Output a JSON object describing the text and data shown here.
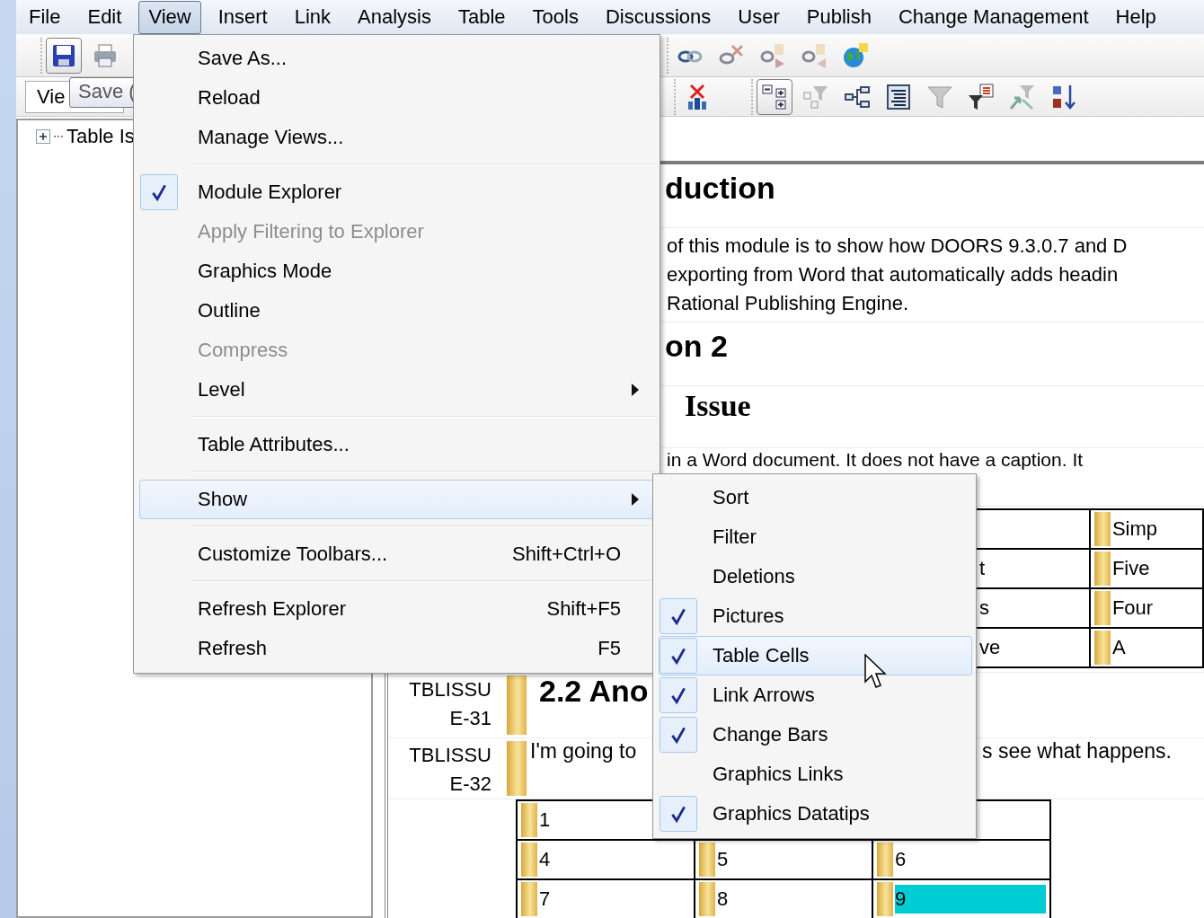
{
  "menu_bar": [
    {
      "label": "File",
      "selected": false
    },
    {
      "label": "Edit",
      "selected": false
    },
    {
      "label": "View",
      "selected": true
    },
    {
      "label": "Insert",
      "selected": false
    },
    {
      "label": "Link",
      "selected": false
    },
    {
      "label": "Analysis",
      "selected": false
    },
    {
      "label": "Table",
      "selected": false
    },
    {
      "label": "Tools",
      "selected": false
    },
    {
      "label": "Discussions",
      "selected": false
    },
    {
      "label": "User",
      "selected": false
    },
    {
      "label": "Publish",
      "selected": false
    },
    {
      "label": "Change Management",
      "selected": false
    },
    {
      "label": "Help",
      "selected": false
    }
  ],
  "toolbars": [
    {
      "groups": [
        {
          "buttons": [
            {
              "kind": "save",
              "pressed": true
            },
            {
              "kind": "print",
              "pressed": false
            }
          ]
        },
        {
          "buttons": [
            {
              "kind": "link",
              "pressed": false
            },
            {
              "kind": "unlink",
              "pressed": false
            },
            {
              "kind": "link_next",
              "pressed": false
            },
            {
              "kind": "link_prev",
              "pressed": false
            },
            {
              "kind": "globe",
              "pressed": false
            }
          ]
        }
      ]
    },
    {
      "view_selector": "Vie",
      "groups": [
        {
          "buttons": [
            {
              "kind": "delete",
              "pressed": false
            }
          ]
        },
        {
          "buttons": [
            {
              "kind": "outline",
              "pressed": true
            },
            {
              "kind": "tree_filter",
              "pressed": false
            },
            {
              "kind": "hierarchy",
              "pressed": false
            },
            {
              "kind": "list",
              "pressed": false
            },
            {
              "kind": "filter",
              "pressed": false
            },
            {
              "kind": "filter_list",
              "pressed": false
            },
            {
              "kind": "arrows_filter",
              "pressed": false
            },
            {
              "kind": "sort",
              "pressed": false
            }
          ]
        }
      ]
    }
  ],
  "tooltip": "Save (",
  "explorer": {
    "items": [
      {
        "label": "Table Is",
        "expanded": false
      }
    ]
  },
  "document": {
    "rows": [
      {
        "kind": "heading",
        "text": "duction"
      },
      {
        "kind": "paragraph",
        "lines": [
          "of this module is to show how DOORS 9.3.0.7 and D",
          "exporting from Word that automatically adds headin",
          "Rational Publishing Engine."
        ]
      },
      {
        "kind": "heading",
        "text": "on 2"
      },
      {
        "kind": "serif_heading",
        "text": "Issue"
      },
      {
        "kind": "paragraph",
        "lines": [
          "in a Word document. It does not have a caption. It"
        ]
      },
      {
        "kind": "table",
        "rows": [
          [
            {},
            {
              "text": "Simp"
            }
          ],
          [
            {
              "text": "t"
            },
            {
              "text": "Five"
            }
          ],
          [
            {
              "text": "s"
            },
            {
              "text": "Four"
            }
          ],
          [
            {
              "text": "ve"
            },
            {
              "text": "A"
            }
          ]
        ]
      },
      {
        "kind": "heading",
        "id": "TBLISSUE-31",
        "text": "2.2 Ano"
      },
      {
        "kind": "split",
        "id": "TBLISSUE-32",
        "texts": [
          "I'm going to",
          "s see what happens."
        ]
      },
      {
        "kind": "grid",
        "rows": [
          [
            {
              "text": "1"
            },
            {},
            {}
          ],
          [
            {
              "text": "4"
            },
            {
              "text": "5"
            },
            {
              "text": "6"
            }
          ],
          [
            {
              "text": "7"
            },
            {
              "text": "8"
            },
            {
              "text": "9",
              "color": "#00ccd4"
            }
          ]
        ]
      }
    ]
  },
  "view_menu": {
    "items": [
      {
        "kind": "item",
        "label": "Save As...",
        "checked": false,
        "disabled": false,
        "selected": false
      },
      {
        "kind": "item",
        "label": "Reload",
        "checked": false,
        "disabled": false,
        "selected": false
      },
      {
        "kind": "item",
        "label": "Manage Views...",
        "checked": false,
        "disabled": false,
        "selected": false
      },
      {
        "kind": "separator"
      },
      {
        "kind": "item",
        "label": "Module Explorer",
        "checked": true,
        "disabled": false,
        "selected": false
      },
      {
        "kind": "item",
        "label": "Apply Filtering to Explorer",
        "checked": false,
        "disabled": true,
        "selected": false
      },
      {
        "kind": "item",
        "label": "Graphics Mode",
        "checked": false,
        "disabled": false,
        "selected": false
      },
      {
        "kind": "item",
        "label": "Outline",
        "checked": false,
        "disabled": false,
        "selected": false
      },
      {
        "kind": "item",
        "label": "Compress",
        "checked": false,
        "disabled": true,
        "selected": false
      },
      {
        "kind": "submenu",
        "label": "Level",
        "checked": false,
        "disabled": false,
        "selected": false
      },
      {
        "kind": "separator"
      },
      {
        "kind": "item",
        "label": "Table Attributes...",
        "checked": false,
        "disabled": false,
        "selected": false
      },
      {
        "kind": "separator"
      },
      {
        "kind": "submenu",
        "label": "Show",
        "checked": false,
        "disabled": false,
        "selected": true
      },
      {
        "kind": "separator"
      },
      {
        "kind": "item",
        "label": "Customize Toolbars...",
        "shortcut": "Shift+Ctrl+O",
        "checked": false,
        "disabled": false,
        "selected": false
      },
      {
        "kind": "separator"
      },
      {
        "kind": "item",
        "label": "Refresh Explorer",
        "shortcut": "Shift+F5",
        "checked": false,
        "disabled": false,
        "selected": false
      },
      {
        "kind": "item",
        "label": "Refresh",
        "shortcut": "F5",
        "checked": false,
        "disabled": false,
        "selected": false
      }
    ]
  },
  "show_submenu": {
    "items": [
      {
        "kind": "item",
        "label": "Sort",
        "checked": false,
        "disabled": false,
        "selected": false
      },
      {
        "kind": "item",
        "label": "Filter",
        "checked": false,
        "disabled": false,
        "selected": false
      },
      {
        "kind": "item",
        "label": "Deletions",
        "checked": false,
        "disabled": false,
        "selected": false
      },
      {
        "kind": "item",
        "label": "Pictures",
        "checked": true,
        "disabled": false,
        "selected": false
      },
      {
        "kind": "item",
        "label": "Table Cells",
        "checked": true,
        "disabled": false,
        "selected": true
      },
      {
        "kind": "item",
        "label": "Link Arrows",
        "checked": true,
        "disabled": false,
        "selected": false
      },
      {
        "kind": "item",
        "label": "Change Bars",
        "checked": true,
        "disabled": false,
        "selected": false
      },
      {
        "kind": "item",
        "label": "Graphics Links",
        "checked": false,
        "disabled": false,
        "selected": false
      },
      {
        "kind": "item",
        "label": "Graphics Datatips",
        "checked": true,
        "disabled": false,
        "selected": false
      }
    ]
  }
}
